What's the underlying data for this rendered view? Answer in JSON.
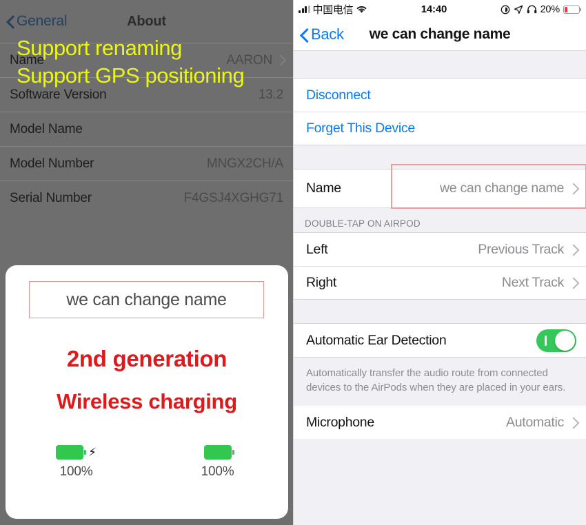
{
  "left": {
    "about": {
      "back_label": "General",
      "title": "About",
      "rows": [
        {
          "label": "Name",
          "value": "AARON",
          "chevron": true
        },
        {
          "label": "Software Version",
          "value": "13.2",
          "chevron": false
        },
        {
          "label": "Model Name",
          "value": "",
          "chevron": false
        },
        {
          "label": "Model Number",
          "value": "MNGX2CH/A",
          "chevron": false
        },
        {
          "label": "Serial Number",
          "value": "F4GSJ4XGHG71",
          "chevron": false
        }
      ]
    },
    "overlay": {
      "line1": "Support renaming",
      "line2": "Support GPS positioning",
      "color": "#eaf715"
    },
    "card": {
      "name_box_text": "we can change name",
      "headline1": "2nd generation",
      "headline2": "Wireless charging",
      "headline_color": "#e0191c",
      "box_border_color": "#f0908f",
      "batteries": [
        {
          "percent": "100%",
          "charging": true,
          "level": 100
        },
        {
          "percent": "100%",
          "charging": false,
          "level": 100
        }
      ],
      "battery_color": "#32c850"
    }
  },
  "right": {
    "status_bar": {
      "carrier": "中国电信",
      "signal_icon": "signal-bars-icon",
      "wifi_icon": "wifi-icon",
      "time": "14:40",
      "alarm_icon": "alarm-icon",
      "location_icon": "location-arrow-icon",
      "headphones_icon": "headphones-icon",
      "battery_percent": "20%",
      "battery_level": 20,
      "battery_color": "#f1363b"
    },
    "nav": {
      "back_label": "Back",
      "title": "we can change name",
      "tint": "#0a7cf0"
    },
    "actions": [
      {
        "label": "Disconnect",
        "style": "link"
      },
      {
        "label": "Forget This Device",
        "style": "link"
      }
    ],
    "name_cell": {
      "label": "Name",
      "value": "we can change name",
      "highlight_color": "#e79e9e"
    },
    "doubletap": {
      "header": "DOUBLE-TAP ON AIRPOD",
      "rows": [
        {
          "label": "Left",
          "value": "Previous Track"
        },
        {
          "label": "Right",
          "value": "Next Track"
        }
      ]
    },
    "ear_detection": {
      "label": "Automatic Ear Detection",
      "enabled": true,
      "toggle_color": "#34c759",
      "footnote": "Automatically transfer the audio route from connected devices to the AirPods when they are placed in your ears."
    },
    "microphone": {
      "label": "Microphone",
      "value": "Automatic"
    }
  }
}
